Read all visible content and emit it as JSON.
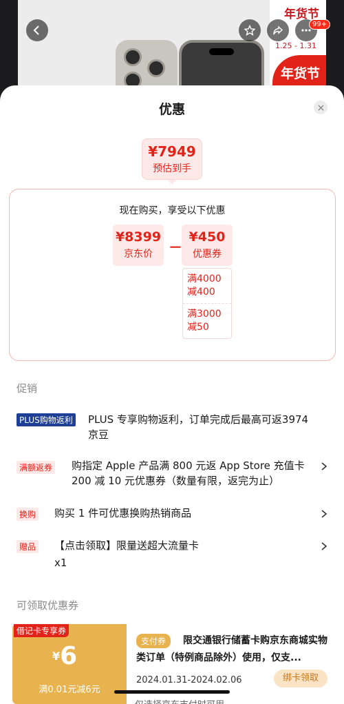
{
  "header": {
    "promo_title": "年货节",
    "promo_date": "1.25 - 1.31",
    "promo_red_text": "年货节",
    "cart_count": "99+"
  },
  "sheet": {
    "title": "优惠",
    "estimate": {
      "price": "¥7949",
      "label": "预估到手"
    },
    "calc": {
      "title": "现在购买，享受以下优惠",
      "jd_price": {
        "value": "¥8399",
        "label": "京东价"
      },
      "minus": "－",
      "coupon": {
        "value": "¥450",
        "label": "优惠券"
      },
      "coupon_items": [
        {
          "line1": "满4000",
          "line2": "减400"
        },
        {
          "line1": "满3000",
          "line2": "减50"
        }
      ]
    },
    "promotions_heading": "促销",
    "promotions": [
      {
        "tag": "PLUS购物返利",
        "text": "PLUS 专享购物返利，订单完成后最高可返3974 京豆"
      },
      {
        "tag": "满额返券",
        "text": "购指定 Apple 产品满 800 元返 App Store 充值卡 200 减 10 元优惠券（数量有限，返完为止）"
      },
      {
        "tag": "换购",
        "text": "购买 1 件可优惠换购热销商品"
      },
      {
        "tag": "赠品",
        "text": "【点击领取】限量送超大流量卡",
        "extra": "x1"
      }
    ],
    "coupons_heading": "可领取优惠券",
    "voucher": {
      "ribbon": "借记卡专享券",
      "currency": "¥",
      "amount": "6",
      "condition": "满0.01元减6元",
      "tag": "支付券",
      "description": "限交通银行储蓄卡购京东商城实物类订单（特例商品除外）使用，仅支...",
      "date": "2024.01.31-2024.02.06",
      "button": "绑卡领取",
      "note": "仅选择京东支付时可用"
    }
  },
  "colors": {
    "accent": "#e2231a",
    "plus": "#1e3f96",
    "voucher": "#e8b24f"
  }
}
